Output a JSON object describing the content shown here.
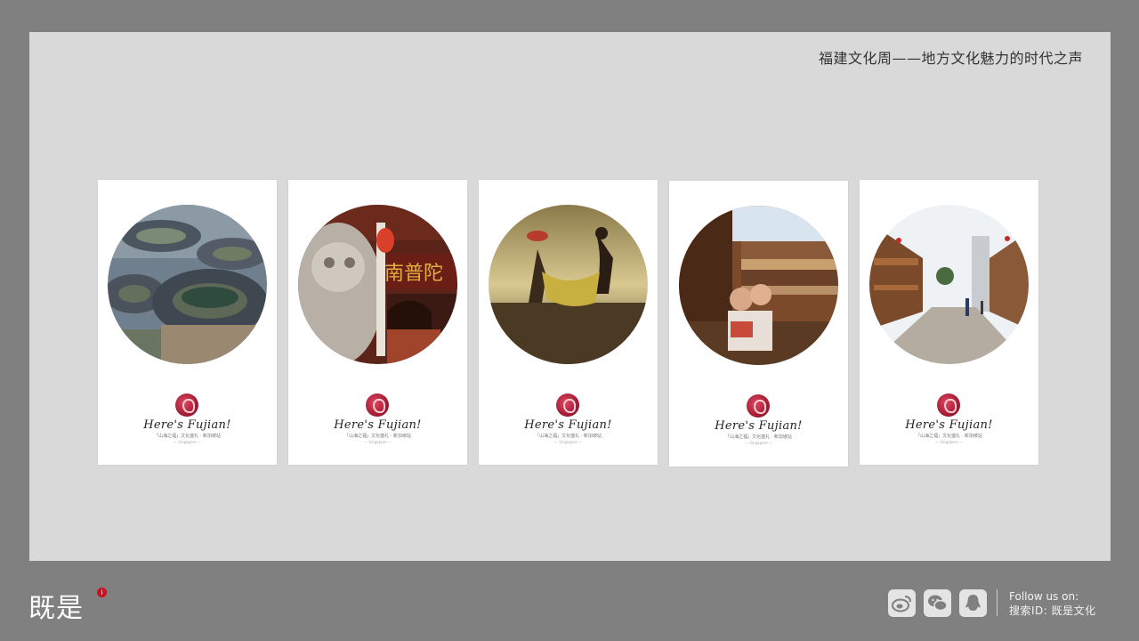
{
  "slide": {
    "title": "福建文化周——地方文化魅力的时代之声"
  },
  "cards": [
    {
      "title": "Here's Fujian!",
      "subtitle": "「山海之福」文化盛礼 · 新加坡站",
      "footer": "— Singapore —",
      "image": "tulou-aerial"
    },
    {
      "title": "Here's Fujian!",
      "subtitle": "「山海之福」文化盛礼 · 新加坡站",
      "footer": "— Singapore —",
      "image": "temple-stone-lion",
      "sign_text": "南普陀"
    },
    {
      "title": "Here's Fujian!",
      "subtitle": "「山海之福」文化盛礼 · 新加坡站",
      "footer": "— Singapore —",
      "image": "fishermen-beach"
    },
    {
      "title": "Here's Fujian!",
      "subtitle": "「山海之福」文化盛礼 · 新加坡站",
      "footer": "— Singapore —",
      "image": "children-reading-tulou"
    },
    {
      "title": "Here's Fujian!",
      "subtitle": "「山海之福」文化盛礼 · 新加坡站",
      "footer": "— Singapore —",
      "image": "old-street"
    }
  ],
  "footer": {
    "logo": "既是",
    "logo_badge": "i",
    "follow_label": "Follow us on:",
    "search_id": "搜索ID: 既是文化",
    "icons": [
      "weibo-icon",
      "wechat-icon",
      "qq-icon"
    ]
  }
}
